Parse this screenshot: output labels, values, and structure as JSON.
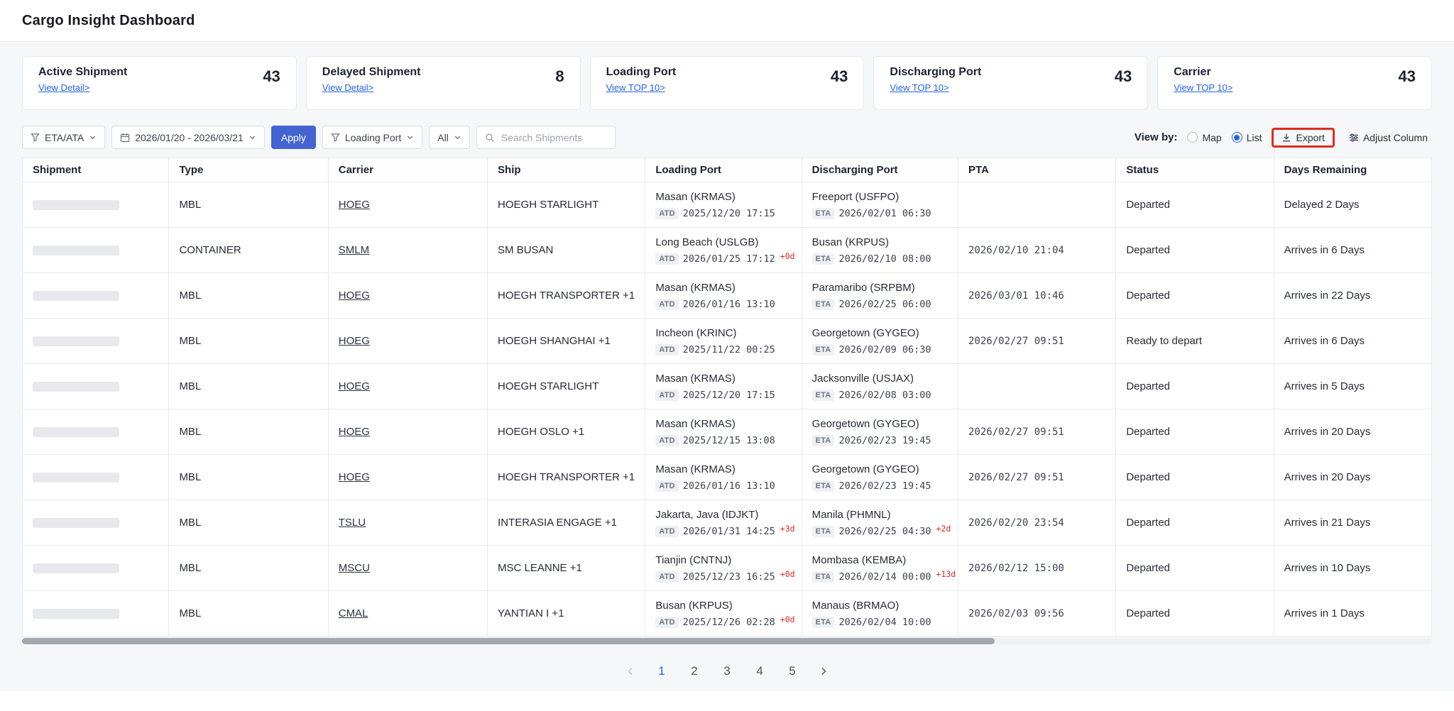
{
  "header": {
    "title": "Cargo Insight Dashboard"
  },
  "cards": [
    {
      "label": "Active Shipment",
      "value": "43",
      "link": "View Detail>"
    },
    {
      "label": "Delayed Shipment",
      "value": "8",
      "link": "View Detail>"
    },
    {
      "label": "Loading Port",
      "value": "43",
      "link": "View TOP 10>"
    },
    {
      "label": "Discharging Port",
      "value": "43",
      "link": "View TOP 10>"
    },
    {
      "label": "Carrier",
      "value": "43",
      "link": "View TOP 10>"
    }
  ],
  "filters": {
    "eta_ata_label": "ETA/ATA",
    "date_range": "2026/01/20 - 2026/03/21",
    "apply_label": "Apply",
    "loading_port_label": "Loading Port",
    "all_label": "All",
    "search_placeholder": "Search Shipments",
    "view_by_label": "View by:",
    "map_label": "Map",
    "list_label": "List",
    "view_selected": "List",
    "export_label": "Export",
    "adjust_column_label": "Adjust Column"
  },
  "table": {
    "columns": [
      "Shipment",
      "Type",
      "Carrier",
      "Ship",
      "Loading Port",
      "Discharging Port",
      "PTA",
      "Status",
      "Days Remaining"
    ],
    "rows": [
      {
        "type": "MBL",
        "carrier": "HOEG",
        "ship": "HOEGH STARLIGHT",
        "loading_port": {
          "name": "Masan (KRMAS)",
          "badge": "ATD",
          "datetime": "2025/12/20 17:15",
          "delay": ""
        },
        "discharging_port": {
          "name": "Freeport (USFPO)",
          "badge": "ETA",
          "datetime": "2026/02/01 06:30",
          "delay": ""
        },
        "pta": "",
        "status": "Departed",
        "days_remaining": "Delayed 2 Days"
      },
      {
        "type": "CONTAINER",
        "carrier": "SMLM",
        "ship": "SM BUSAN",
        "loading_port": {
          "name": "Long Beach (USLGB)",
          "badge": "ATD",
          "datetime": "2026/01/25 17:12",
          "delay": "+0d"
        },
        "discharging_port": {
          "name": "Busan (KRPUS)",
          "badge": "ETA",
          "datetime": "2026/02/10 08:00",
          "delay": ""
        },
        "pta": "2026/02/10 21:04",
        "status": "Departed",
        "days_remaining": "Arrives in 6 Days"
      },
      {
        "type": "MBL",
        "carrier": "HOEG",
        "ship": "HOEGH TRANSPORTER +1",
        "loading_port": {
          "name": "Masan (KRMAS)",
          "badge": "ATD",
          "datetime": "2026/01/16 13:10",
          "delay": ""
        },
        "discharging_port": {
          "name": "Paramaribo (SRPBM)",
          "badge": "ETA",
          "datetime": "2026/02/25 06:00",
          "delay": ""
        },
        "pta": "2026/03/01 10:46",
        "status": "Departed",
        "days_remaining": "Arrives in 22 Days"
      },
      {
        "type": "MBL",
        "carrier": "HOEG",
        "ship": "HOEGH SHANGHAI +1",
        "loading_port": {
          "name": "Incheon (KRINC)",
          "badge": "ATD",
          "datetime": "2025/11/22 00:25",
          "delay": ""
        },
        "discharging_port": {
          "name": "Georgetown (GYGEO)",
          "badge": "ETA",
          "datetime": "2026/02/09 06:30",
          "delay": ""
        },
        "pta": "2026/02/27 09:51",
        "status": "Ready to depart",
        "days_remaining": "Arrives in 6 Days"
      },
      {
        "type": "MBL",
        "carrier": "HOEG",
        "ship": "HOEGH STARLIGHT",
        "loading_port": {
          "name": "Masan (KRMAS)",
          "badge": "ATD",
          "datetime": "2025/12/20 17:15",
          "delay": ""
        },
        "discharging_port": {
          "name": "Jacksonville (USJAX)",
          "badge": "ETA",
          "datetime": "2026/02/08 03:00",
          "delay": ""
        },
        "pta": "",
        "status": "Departed",
        "days_remaining": "Arrives in 5 Days"
      },
      {
        "type": "MBL",
        "carrier": "HOEG",
        "ship": "HOEGH OSLO +1",
        "loading_port": {
          "name": "Masan (KRMAS)",
          "badge": "ATD",
          "datetime": "2025/12/15 13:08",
          "delay": ""
        },
        "discharging_port": {
          "name": "Georgetown (GYGEO)",
          "badge": "ETA",
          "datetime": "2026/02/23 19:45",
          "delay": ""
        },
        "pta": "2026/02/27 09:51",
        "status": "Departed",
        "days_remaining": "Arrives in 20 Days"
      },
      {
        "type": "MBL",
        "carrier": "HOEG",
        "ship": "HOEGH TRANSPORTER +1",
        "loading_port": {
          "name": "Masan (KRMAS)",
          "badge": "ATD",
          "datetime": "2026/01/16 13:10",
          "delay": ""
        },
        "discharging_port": {
          "name": "Georgetown (GYGEO)",
          "badge": "ETA",
          "datetime": "2026/02/23 19:45",
          "delay": ""
        },
        "pta": "2026/02/27 09:51",
        "status": "Departed",
        "days_remaining": "Arrives in 20 Days"
      },
      {
        "type": "MBL",
        "carrier": "TSLU",
        "ship": "INTERASIA ENGAGE +1",
        "loading_port": {
          "name": "Jakarta, Java (IDJKT)",
          "badge": "ATD",
          "datetime": "2026/01/31 14:25",
          "delay": "+3d"
        },
        "discharging_port": {
          "name": "Manila (PHMNL)",
          "badge": "ETA",
          "datetime": "2026/02/25 04:30",
          "delay": "+2d"
        },
        "pta": "2026/02/20 23:54",
        "status": "Departed",
        "days_remaining": "Arrives in 21 Days"
      },
      {
        "type": "MBL",
        "carrier": "MSCU",
        "ship": "MSC LEANNE +1",
        "loading_port": {
          "name": "Tianjin (CNTNJ)",
          "badge": "ATD",
          "datetime": "2025/12/23 16:25",
          "delay": "+0d"
        },
        "discharging_port": {
          "name": "Mombasa (KEMBA)",
          "badge": "ETA",
          "datetime": "2026/02/14 00:00",
          "delay": "+13d"
        },
        "pta": "2026/02/12 15:00",
        "status": "Departed",
        "days_remaining": "Arrives in 10 Days"
      },
      {
        "type": "MBL",
        "carrier": "CMAL",
        "ship": "YANTIAN I +1",
        "loading_port": {
          "name": "Busan (KRPUS)",
          "badge": "ATD",
          "datetime": "2025/12/26 02:28",
          "delay": "+0d"
        },
        "discharging_port": {
          "name": "Manaus (BRMAO)",
          "badge": "ETA",
          "datetime": "2026/02/04 10:00",
          "delay": ""
        },
        "pta": "2026/02/03 09:56",
        "status": "Departed",
        "days_remaining": "Arrives in 1 Days"
      }
    ]
  },
  "pagination": {
    "pages": [
      "1",
      "2",
      "3",
      "4",
      "5"
    ],
    "active": "1"
  },
  "colors": {
    "accent_blue": "#2563eb",
    "apply_button": "#4464d2",
    "annotation_red": "#e02b1d",
    "delay_red": "#dc2626"
  },
  "icons": [
    "filter-funnel-icon",
    "calendar-icon",
    "chevron-down-icon",
    "search-icon",
    "download-icon",
    "adjust-column-icon",
    "chevron-left-icon",
    "chevron-right-icon"
  ]
}
